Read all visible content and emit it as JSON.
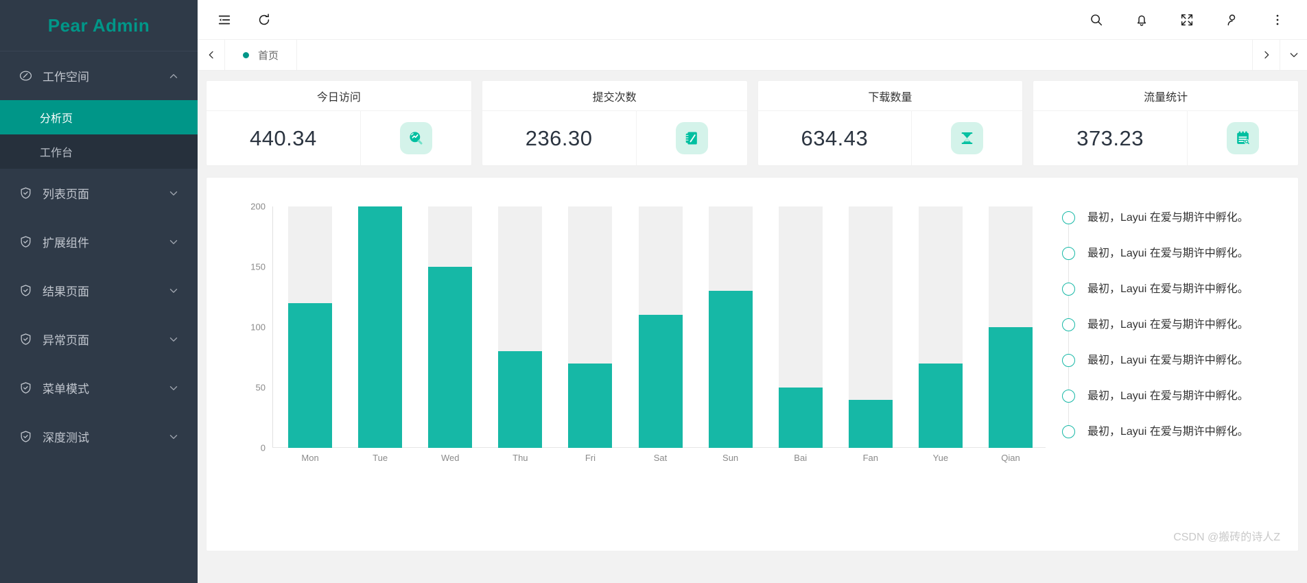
{
  "sidebar": {
    "brand": "Pear Admin",
    "groups": [
      {
        "label": "工作空间",
        "icon": "dashboard-icon",
        "expanded": true,
        "children": [
          {
            "label": "分析页",
            "active": true
          },
          {
            "label": "工作台",
            "active": false
          }
        ]
      },
      {
        "label": "列表页面",
        "icon": "shield-check-icon",
        "expanded": false,
        "children": []
      },
      {
        "label": "扩展组件",
        "icon": "shield-check-icon",
        "expanded": false,
        "children": []
      },
      {
        "label": "结果页面",
        "icon": "shield-check-icon",
        "expanded": false,
        "children": []
      },
      {
        "label": "异常页面",
        "icon": "shield-check-icon",
        "expanded": false,
        "children": []
      },
      {
        "label": "菜单模式",
        "icon": "shield-check-icon",
        "expanded": false,
        "children": []
      },
      {
        "label": "深度测试",
        "icon": "shield-check-icon",
        "expanded": false,
        "children": []
      }
    ]
  },
  "topbar": {
    "left_icons": [
      {
        "name": "menu-collapse-icon"
      },
      {
        "name": "refresh-icon"
      }
    ],
    "right_icons": [
      {
        "name": "search-icon"
      },
      {
        "name": "bell-icon"
      },
      {
        "name": "fullscreen-icon"
      },
      {
        "name": "user-icon"
      },
      {
        "name": "more-vertical-icon"
      }
    ]
  },
  "tabbar": {
    "prev_icon": "chevron-left-icon",
    "next_icon": "chevron-right-icon",
    "menu_icon": "chevron-down-icon",
    "tabs": [
      {
        "label": "首页",
        "active": true
      }
    ]
  },
  "cards": [
    {
      "title": "今日访问",
      "value": "440.34",
      "icon": "chart-search-icon",
      "accent": "#00bfa0",
      "bg": "#d4f3ea"
    },
    {
      "title": "提交次数",
      "value": "236.30",
      "icon": "notebook-pen-icon",
      "accent": "#00bfa0",
      "bg": "#d4f3ea"
    },
    {
      "title": "下载数量",
      "value": "634.43",
      "icon": "hourglass-icon",
      "accent": "#00bfa0",
      "bg": "#d4f3ea"
    },
    {
      "title": "流量统计",
      "value": "373.23",
      "icon": "clipboard-search-icon",
      "accent": "#00bfa0",
      "bg": "#d4f3ea"
    }
  ],
  "chart_data": {
    "type": "bar",
    "title": "",
    "xlabel": "",
    "ylabel": "",
    "categories": [
      "Mon",
      "Tue",
      "Wed",
      "Thu",
      "Fri",
      "Sat",
      "Sun",
      "Bai",
      "Fan",
      "Yue",
      "Qian"
    ],
    "values": [
      120,
      200,
      150,
      80,
      70,
      110,
      130,
      50,
      40,
      70,
      100
    ],
    "ylim": [
      0,
      200
    ],
    "yticks": [
      0,
      50,
      100,
      150,
      200
    ],
    "ytick_labels": [
      "0",
      "50",
      "100",
      "150",
      "200"
    ],
    "grid": false,
    "legend": "none",
    "bar_color": "#16b8a6",
    "background_bar_color": "#f0f0f0",
    "background_bar_value": 200
  },
  "timeline": {
    "items": [
      {
        "text": "最初，Layui 在爱与期许中孵化。"
      },
      {
        "text": "最初，Layui 在爱与期许中孵化。"
      },
      {
        "text": "最初，Layui 在爱与期许中孵化。"
      },
      {
        "text": "最初，Layui 在爱与期许中孵化。"
      },
      {
        "text": "最初，Layui 在爱与期许中孵化。"
      },
      {
        "text": "最初，Layui 在爱与期许中孵化。"
      },
      {
        "text": "最初，Layui 在爱与期许中孵化。"
      }
    ]
  },
  "watermark": "CSDN @搬砖的诗人Z"
}
